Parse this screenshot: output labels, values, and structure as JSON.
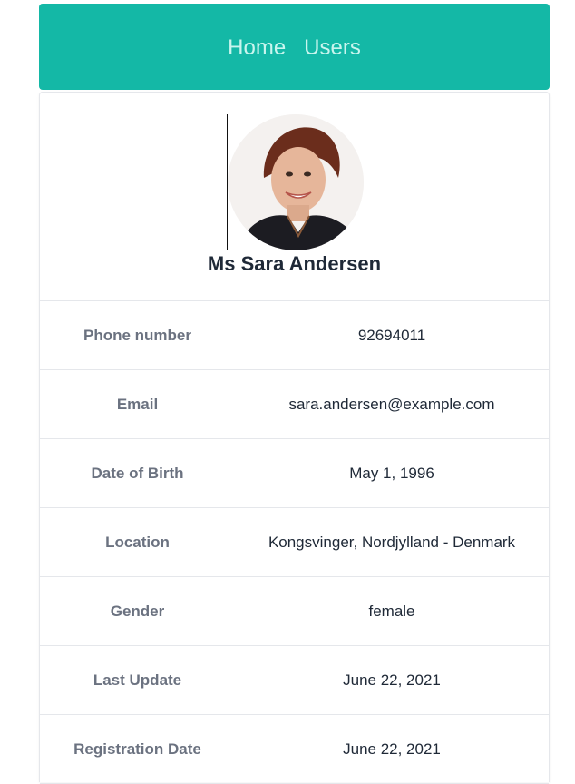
{
  "nav": {
    "home_label": "Home",
    "users_label": "Users"
  },
  "colors": {
    "navbar": "#14b8a6",
    "nav_link": "#c9f5ee"
  },
  "profile": {
    "name": "Ms Sara Andersen",
    "avatar_icon": "user-photo"
  },
  "details": [
    {
      "label": "Phone number",
      "value": "92694011"
    },
    {
      "label": "Email",
      "value": "sara.andersen@example.com"
    },
    {
      "label": "Date of Birth",
      "value": "May 1, 1996"
    },
    {
      "label": "Location",
      "value": "Kongsvinger, Nordjylland - Denmark"
    },
    {
      "label": "Gender",
      "value": "female"
    },
    {
      "label": "Last Update",
      "value": "June 22, 2021"
    },
    {
      "label": "Registration Date",
      "value": "June 22, 2021"
    }
  ]
}
